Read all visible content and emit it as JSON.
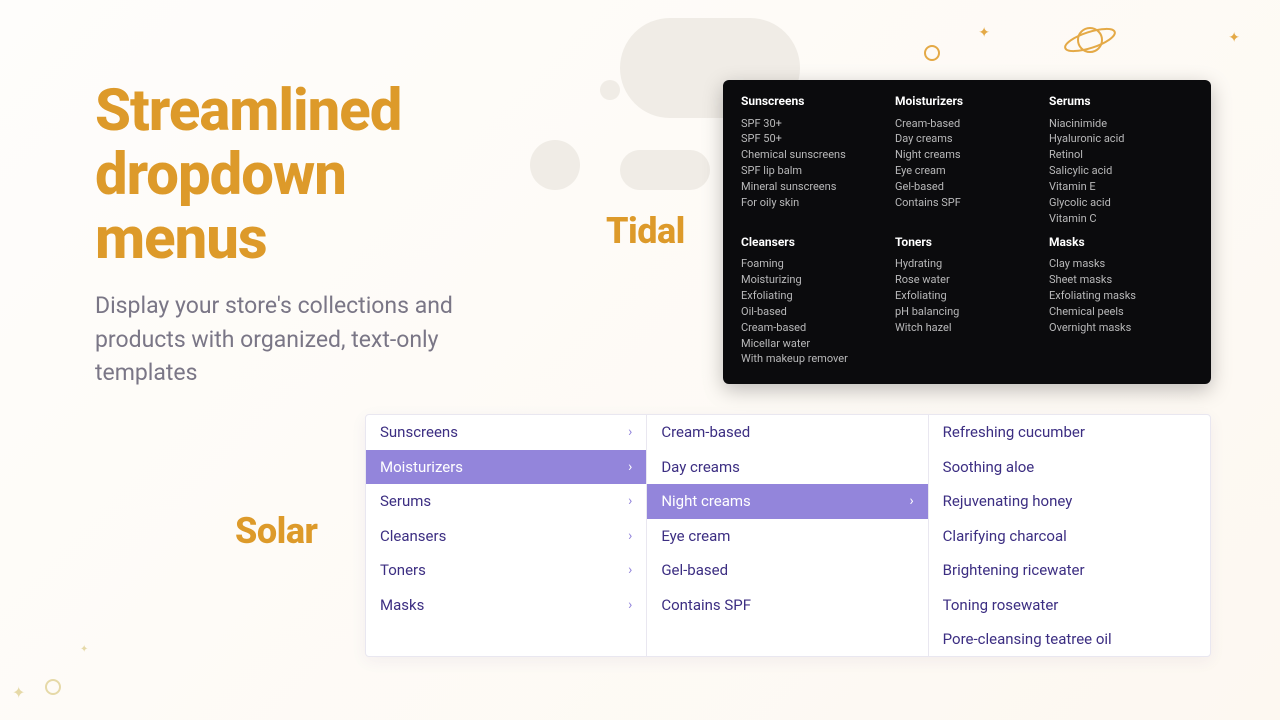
{
  "hero": {
    "title": "Streamlined dropdown menus",
    "subtitle": "Display your store's collections and products with organized, text-only templates"
  },
  "labels": {
    "tidal": "Tidal",
    "solar": "Solar"
  },
  "tidal": {
    "cols": [
      {
        "title": "Sunscreens",
        "items": [
          "SPF 30+",
          "SPF 50+",
          "Chemical sunscreens",
          "SPF lip balm",
          "Mineral sunscreens",
          "For oily skin"
        ]
      },
      {
        "title": "Moisturizers",
        "items": [
          "Cream-based",
          "Day creams",
          "Night creams",
          "Eye cream",
          "Gel-based",
          "Contains SPF"
        ]
      },
      {
        "title": "Serums",
        "items": [
          "Niacinimide",
          "Hyaluronic acid",
          "Retinol",
          "Salicylic acid",
          "Vitamin E",
          "Glycolic acid",
          "Vitamin C"
        ]
      },
      {
        "title": "Cleansers",
        "items": [
          "Foaming",
          "Moisturizing",
          "Exfoliating",
          "Oil-based",
          "Cream-based",
          "Micellar water",
          "With makeup remover"
        ]
      },
      {
        "title": "Toners",
        "items": [
          "Hydrating",
          "Rose water",
          "Exfoliating",
          "pH balancing",
          "Witch hazel"
        ]
      },
      {
        "title": "Masks",
        "items": [
          "Clay masks",
          "Sheet masks",
          "Exfoliating masks",
          "Chemical peels",
          "Overnight masks"
        ]
      }
    ]
  },
  "solar": {
    "col1": [
      {
        "label": "Sunscreens",
        "active": false
      },
      {
        "label": "Moisturizers",
        "active": true
      },
      {
        "label": "Serums",
        "active": false
      },
      {
        "label": "Cleansers",
        "active": false
      },
      {
        "label": "Toners",
        "active": false
      },
      {
        "label": "Masks",
        "active": false
      }
    ],
    "col2": [
      {
        "label": "Cream-based",
        "active": false
      },
      {
        "label": "Day creams",
        "active": false
      },
      {
        "label": "Night creams",
        "active": true
      },
      {
        "label": "Eye cream",
        "active": false
      },
      {
        "label": "Gel-based",
        "active": false
      },
      {
        "label": "Contains SPF",
        "active": false
      }
    ],
    "col3": [
      "Refreshing cucumber",
      "Soothing aloe",
      "Rejuvenating honey",
      "Clarifying charcoal",
      "Brightening ricewater",
      "Toning rosewater",
      "Pore-cleansing teatree oil"
    ]
  }
}
